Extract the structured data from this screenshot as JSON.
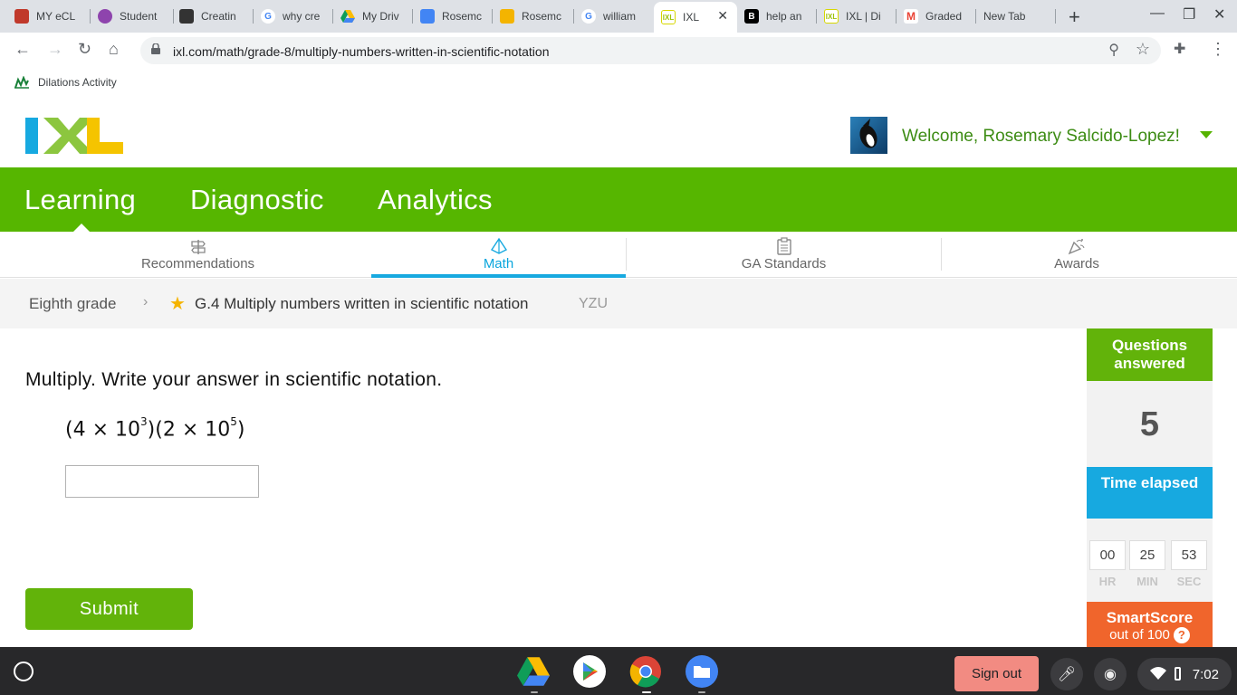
{
  "browser": {
    "tabs": [
      {
        "label": "MY eCL",
        "fav_color": "#c0392b",
        "fav_text": ""
      },
      {
        "label": "Student",
        "fav_color": "#8e44ad",
        "fav_text": ""
      },
      {
        "label": "Creatin",
        "fav_color": "#333333",
        "fav_text": ""
      },
      {
        "label": "why cre",
        "fav_color": "#4285f4",
        "fav_text": "G"
      },
      {
        "label": "My Driv",
        "fav_color": "#0f9d58",
        "fav_text": ""
      },
      {
        "label": "Rosemc",
        "fav_color": "#4285f4",
        "fav_text": ""
      },
      {
        "label": "Rosemc",
        "fav_color": "#f4b400",
        "fav_text": ""
      },
      {
        "label": "william",
        "fav_color": "#4285f4",
        "fav_text": "G"
      },
      {
        "label": "IXL",
        "fav_color": "#d7d700",
        "fav_text": "IXL"
      },
      {
        "label": "help an",
        "fav_color": "#000000",
        "fav_text": "B"
      },
      {
        "label": "IXL | Di",
        "fav_color": "#d7d700",
        "fav_text": "IXL"
      },
      {
        "label": "Graded",
        "fav_color": "#ea4335",
        "fav_text": "M"
      },
      {
        "label": "New Tab",
        "fav_color": "",
        "fav_text": ""
      }
    ],
    "active_tab_index": 8,
    "url": "ixl.com/math/grade-8/multiply-numbers-written-in-scientific-notation",
    "bookmark": "Dilations Activity"
  },
  "header": {
    "welcome": "Welcome, Rosemary Salcido-Lopez!"
  },
  "mainnav": {
    "items": [
      "Learning",
      "Diagnostic",
      "Analytics"
    ],
    "active": "Learning"
  },
  "subnav": {
    "items": [
      "Recommendations",
      "Math",
      "GA Standards",
      "Awards"
    ],
    "active": "Math"
  },
  "breadcrumb": {
    "grade": "Eighth grade",
    "skill": "G.4 Multiply numbers written in scientific notation",
    "code": "YZU"
  },
  "question": {
    "prompt": "Multiply. Write your answer in scientific notation.",
    "expr": {
      "a_coef": "4",
      "a_base": "10",
      "a_exp": "3",
      "b_coef": "2",
      "b_base": "10",
      "b_exp": "5"
    },
    "answer_value": "",
    "submit_label": "Submit"
  },
  "sidebar": {
    "questions_title": "Questions answered",
    "questions_count": "5",
    "time_title": "Time elapsed",
    "time": {
      "hr": "00",
      "min": "25",
      "sec": "53"
    },
    "time_labels": {
      "hr": "HR",
      "min": "MIN",
      "sec": "SEC"
    },
    "smartscore_title": "SmartScore",
    "smartscore_sub": "out of 100",
    "help": "?"
  },
  "shelf": {
    "signout": "Sign out",
    "time": "7:02"
  },
  "colors": {
    "brand_green": "#56b600",
    "brand_blue": "#17a9e0",
    "brand_orange": "#f0652c"
  }
}
